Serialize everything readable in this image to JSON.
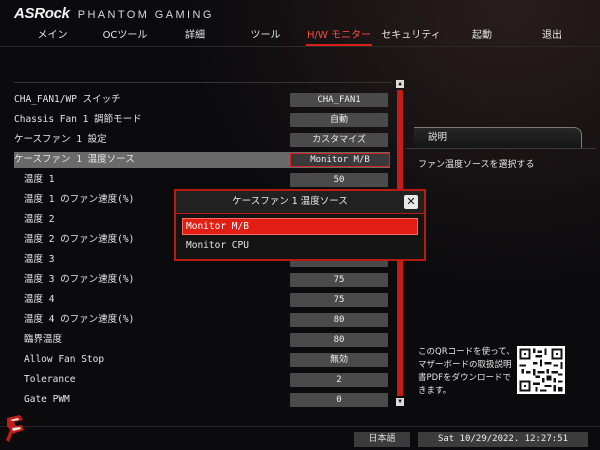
{
  "brand": {
    "logo": "ASRock",
    "subtitle": "PHANTOM GAMING"
  },
  "nav": {
    "tabs": [
      {
        "label": "メイン"
      },
      {
        "label": "OCツール"
      },
      {
        "label": "詳細"
      },
      {
        "label": "ツール"
      },
      {
        "label": "H/W モニター",
        "active": true
      },
      {
        "label": "セキュリティ"
      },
      {
        "label": "起動"
      },
      {
        "label": "退出"
      }
    ]
  },
  "settings": [
    {
      "label": "CHA_FAN1/WP スイッチ",
      "value": "CHA_FAN1"
    },
    {
      "label": "Chassis Fan 1 調節モード",
      "value": "自動"
    },
    {
      "label": "ケースファン 1 設定",
      "value": "カスタマイズ"
    },
    {
      "label": "ケースファン 1 温度ソース",
      "value": "Monitor M/B"
    },
    {
      "label": "温度 1",
      "value": "50"
    },
    {
      "label": "温度 1 のファン速度(%)",
      "value": ""
    },
    {
      "label": "温度 2",
      "value": ""
    },
    {
      "label": "温度 2 のファン速度(%)",
      "value": ""
    },
    {
      "label": "温度 3",
      "value": ""
    },
    {
      "label": "温度 3 のファン速度(%)",
      "value": "75"
    },
    {
      "label": "温度 4",
      "value": "75"
    },
    {
      "label": "温度 4 のファン速度(%)",
      "value": "80"
    },
    {
      "label": "臨界温度",
      "value": "80"
    },
    {
      "label": "Allow Fan Stop",
      "value": "無効"
    },
    {
      "label": "Tolerance",
      "value": "2"
    },
    {
      "label": "Gate PWM",
      "value": "0"
    }
  ],
  "help": {
    "title": "説明",
    "text": "ファン温度ソースを選択する",
    "qr_text": "このQRコードを使って、マザーボードの取扱説明書PDFをダウンロードできます。"
  },
  "modal": {
    "title": "ケースファン 1 温度ソース",
    "close_symbol": "✕",
    "options": [
      {
        "label": "Monitor M/B",
        "selected": true
      },
      {
        "label": "Monitor CPU",
        "selected": false
      }
    ]
  },
  "footer": {
    "language": "日本語",
    "datetime": "Sat 10/29/2022. 12:27:51"
  },
  "colors": {
    "accent": "#d4231a",
    "selected_row": "#6a6a6a",
    "value_box": "#4a4a4a",
    "background": "#0b0b0d"
  }
}
